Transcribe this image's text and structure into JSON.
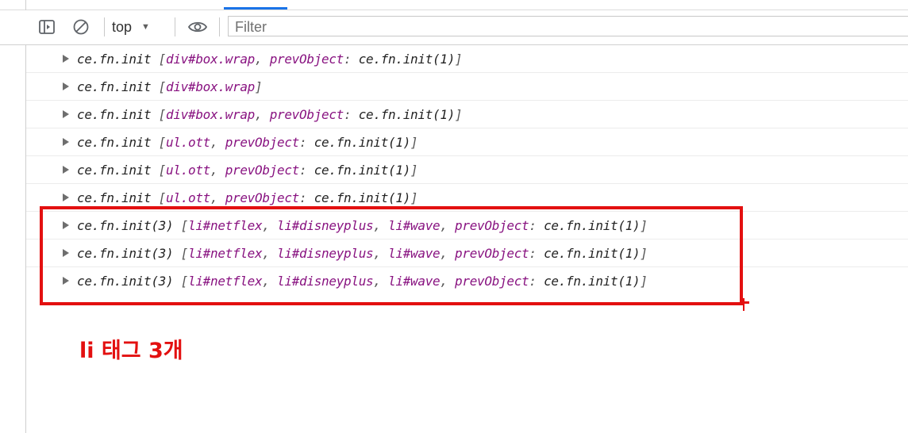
{
  "toolbar": {
    "context": "top",
    "filter_placeholder": "Filter",
    "icons": [
      "sidebar-toggle-icon",
      "clear-console-icon",
      "dropdown-caret-icon",
      "eye-icon"
    ]
  },
  "log_rows": [
    [
      {
        "t": "k",
        "v": "ce.fn.init "
      },
      {
        "t": "p",
        "v": "["
      },
      {
        "t": "n",
        "v": "div#box.wrap"
      },
      {
        "t": "p",
        "v": ", "
      },
      {
        "t": "n",
        "v": "prevObject"
      },
      {
        "t": "p",
        "v": ": "
      },
      {
        "t": "k",
        "v": "ce.fn.init(1)"
      },
      {
        "t": "p",
        "v": "]"
      }
    ],
    [
      {
        "t": "k",
        "v": "ce.fn.init "
      },
      {
        "t": "p",
        "v": "["
      },
      {
        "t": "n",
        "v": "div#box.wrap"
      },
      {
        "t": "p",
        "v": "]"
      }
    ],
    [
      {
        "t": "k",
        "v": "ce.fn.init "
      },
      {
        "t": "p",
        "v": "["
      },
      {
        "t": "n",
        "v": "div#box.wrap"
      },
      {
        "t": "p",
        "v": ", "
      },
      {
        "t": "n",
        "v": "prevObject"
      },
      {
        "t": "p",
        "v": ": "
      },
      {
        "t": "k",
        "v": "ce.fn.init(1)"
      },
      {
        "t": "p",
        "v": "]"
      }
    ],
    [
      {
        "t": "k",
        "v": "ce.fn.init "
      },
      {
        "t": "p",
        "v": "["
      },
      {
        "t": "n",
        "v": "ul.ott"
      },
      {
        "t": "p",
        "v": ", "
      },
      {
        "t": "n",
        "v": "prevObject"
      },
      {
        "t": "p",
        "v": ": "
      },
      {
        "t": "k",
        "v": "ce.fn.init(1)"
      },
      {
        "t": "p",
        "v": "]"
      }
    ],
    [
      {
        "t": "k",
        "v": "ce.fn.init "
      },
      {
        "t": "p",
        "v": "["
      },
      {
        "t": "n",
        "v": "ul.ott"
      },
      {
        "t": "p",
        "v": ", "
      },
      {
        "t": "n",
        "v": "prevObject"
      },
      {
        "t": "p",
        "v": ": "
      },
      {
        "t": "k",
        "v": "ce.fn.init(1)"
      },
      {
        "t": "p",
        "v": "]"
      }
    ],
    [
      {
        "t": "k",
        "v": "ce.fn.init "
      },
      {
        "t": "p",
        "v": "["
      },
      {
        "t": "n",
        "v": "ul.ott"
      },
      {
        "t": "p",
        "v": ", "
      },
      {
        "t": "n",
        "v": "prevObject"
      },
      {
        "t": "p",
        "v": ": "
      },
      {
        "t": "k",
        "v": "ce.fn.init(1)"
      },
      {
        "t": "p",
        "v": "]"
      }
    ],
    [
      {
        "t": "k",
        "v": "ce.fn.init(3) "
      },
      {
        "t": "p",
        "v": "["
      },
      {
        "t": "n",
        "v": "li#netflex"
      },
      {
        "t": "p",
        "v": ", "
      },
      {
        "t": "n",
        "v": "li#disneyplus"
      },
      {
        "t": "p",
        "v": ", "
      },
      {
        "t": "n",
        "v": "li#wave"
      },
      {
        "t": "p",
        "v": ", "
      },
      {
        "t": "n",
        "v": "prevObject"
      },
      {
        "t": "p",
        "v": ": "
      },
      {
        "t": "k",
        "v": "ce.fn.init(1)"
      },
      {
        "t": "p",
        "v": "]"
      }
    ],
    [
      {
        "t": "k",
        "v": "ce.fn.init(3) "
      },
      {
        "t": "p",
        "v": "["
      },
      {
        "t": "n",
        "v": "li#netflex"
      },
      {
        "t": "p",
        "v": ", "
      },
      {
        "t": "n",
        "v": "li#disneyplus"
      },
      {
        "t": "p",
        "v": ", "
      },
      {
        "t": "n",
        "v": "li#wave"
      },
      {
        "t": "p",
        "v": ", "
      },
      {
        "t": "n",
        "v": "prevObject"
      },
      {
        "t": "p",
        "v": ": "
      },
      {
        "t": "k",
        "v": "ce.fn.init(1)"
      },
      {
        "t": "p",
        "v": "]"
      }
    ],
    [
      {
        "t": "k",
        "v": "ce.fn.init(3) "
      },
      {
        "t": "p",
        "v": "["
      },
      {
        "t": "n",
        "v": "li#netflex"
      },
      {
        "t": "p",
        "v": ", "
      },
      {
        "t": "n",
        "v": "li#disneyplus"
      },
      {
        "t": "p",
        "v": ", "
      },
      {
        "t": "n",
        "v": "li#wave"
      },
      {
        "t": "p",
        "v": ", "
      },
      {
        "t": "n",
        "v": "prevObject"
      },
      {
        "t": "p",
        "v": ": "
      },
      {
        "t": "k",
        "v": "ce.fn.init(1)"
      },
      {
        "t": "p",
        "v": "]"
      }
    ]
  ],
  "annotation": {
    "text": "li 태그 3개",
    "color": "#e31010"
  },
  "colors": {
    "highlight": "#e31010",
    "node_name": "#881280",
    "active_tab": "#1a73e8"
  }
}
